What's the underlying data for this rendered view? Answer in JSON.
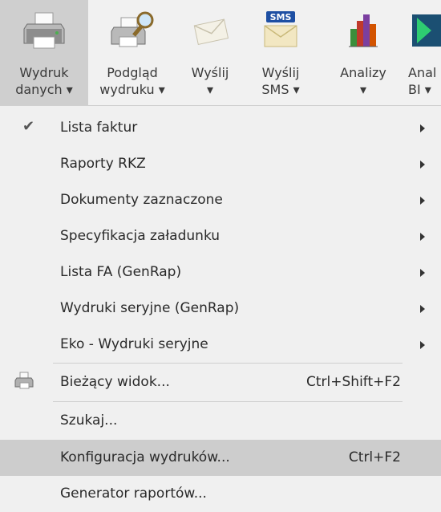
{
  "ribbon": {
    "buttons": [
      {
        "line1": "Wydruk",
        "line2": "danych ▾",
        "icon": "printer-icon"
      },
      {
        "line1": "Podgląd",
        "line2": "wydruku ▾",
        "icon": "print-preview-icon"
      },
      {
        "line1": "Wyślij",
        "line2": "▾",
        "icon": "envelope-icon"
      },
      {
        "line1": "Wyślij",
        "line2": "SMS ▾",
        "icon": "sms-icon",
        "badge": "SMS"
      },
      {
        "line1": "Analizy",
        "line2": "▾",
        "icon": "bar-chart-icon"
      },
      {
        "line1": "Anal",
        "line2": "BI ▾",
        "icon": "bi-icon"
      }
    ]
  },
  "menu": {
    "items": [
      {
        "label": "Lista faktur",
        "checked": true,
        "submenu": true
      },
      {
        "label": "Raporty RKZ",
        "submenu": true
      },
      {
        "label": "Dokumenty zaznaczone",
        "submenu": true
      },
      {
        "label": "Specyfikacja załadunku",
        "submenu": true
      },
      {
        "label": "Lista FA (GenRap)",
        "submenu": true
      },
      {
        "label": "Wydruki seryjne (GenRap)",
        "submenu": true
      },
      {
        "label": "Eko - Wydruki seryjne",
        "submenu": true
      },
      {
        "label": "Bieżący widok...",
        "shortcut": "Ctrl+Shift+F2",
        "icon": "printer-small-icon"
      },
      {
        "label": "Szukaj..."
      },
      {
        "label": "Konfiguracja wydruków...",
        "shortcut": "Ctrl+F2",
        "highlighted": true
      },
      {
        "label": "Generator raportów..."
      }
    ],
    "check_glyph": "✔"
  },
  "colors": {
    "ribbon_bg": "#f1f1f1",
    "active_button_bg": "#cfcfcf",
    "menu_bg": "#f0f0f0",
    "highlight_bg": "#cdcdcd",
    "separator": "#cfcfcf"
  }
}
